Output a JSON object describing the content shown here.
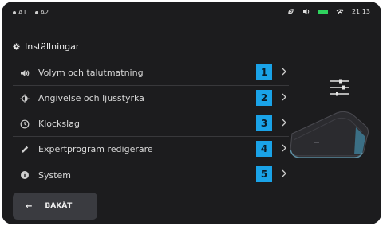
{
  "status": {
    "a1": "A1",
    "a2": "A2",
    "time": "21:13",
    "battery_color": "#2fd35e"
  },
  "header": {
    "title": "Inställningar",
    "icon": "gear-icon"
  },
  "menu": {
    "items": [
      {
        "label": "Volym och talutmatning",
        "number": "1",
        "icon": "speaker-icon"
      },
      {
        "label": "Angivelse och ljusstyrka",
        "number": "2",
        "icon": "brightness-icon"
      },
      {
        "label": "Klockslag",
        "number": "3",
        "icon": "clock-icon"
      },
      {
        "label": "Expertprogram redigerare",
        "number": "4",
        "icon": "pencil-icon"
      },
      {
        "label": "System",
        "number": "5",
        "icon": "info-icon"
      }
    ],
    "accent": "#1aa3e8"
  },
  "back_button": {
    "arrow": "←",
    "label": "BAKÅT"
  }
}
